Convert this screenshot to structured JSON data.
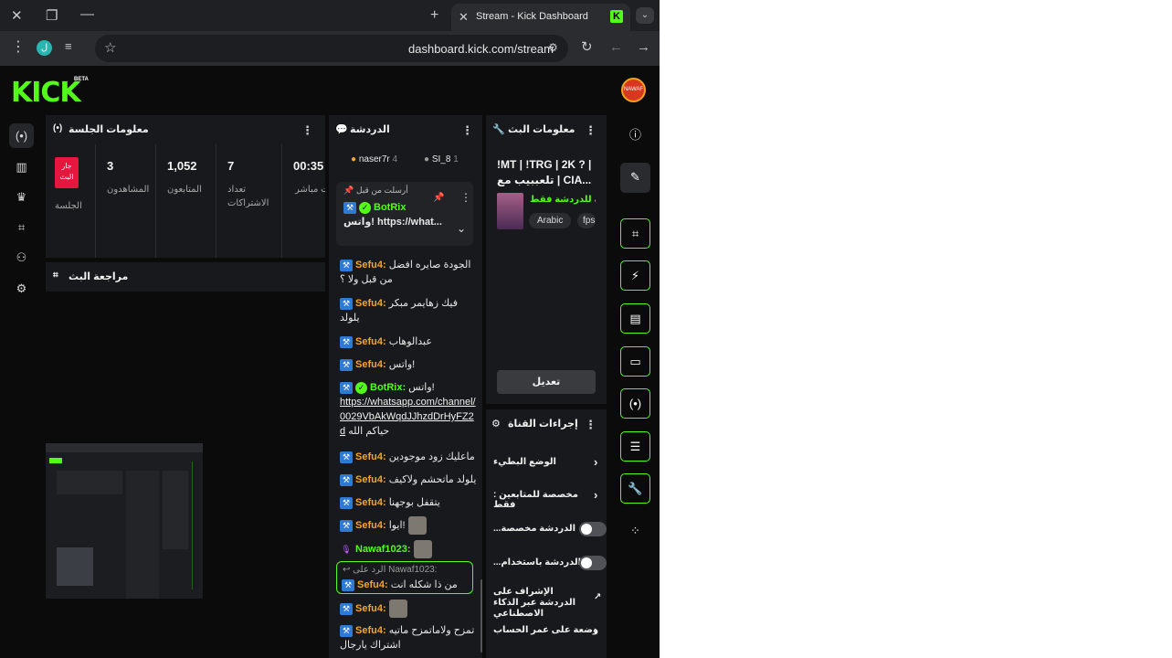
{
  "browser": {
    "tab_title": "Stream - Kick Dashboard",
    "favicon_letter": "K",
    "url": "dashboard.kick.com/stream",
    "profile_letter": "ل"
  },
  "header": {
    "logo": "KICK",
    "beta": "BETA",
    "avatar_text": "NAWAF"
  },
  "session": {
    "title": "معلومات الجلسة",
    "live_badge": "جار البث",
    "live_label": "الجلسة",
    "stats": [
      {
        "value": "3",
        "label": "المشاهدون"
      },
      {
        "value": "1,052",
        "label": "المتابعون"
      },
      {
        "value": "7",
        "label": "تعداد الاشتراكات"
      },
      {
        "value": "00:35",
        "label": "ت مباشر"
      }
    ]
  },
  "review": {
    "title": "مراجعة البث"
  },
  "chat": {
    "title": "الدردشة",
    "top_chatters": [
      {
        "name": "naser7r",
        "count": "4"
      },
      {
        "name": "SI_8",
        "count": "1"
      }
    ],
    "pinned": {
      "sent_by": "أرسلت من قبل",
      "user": "BotRix",
      "text": "واتس! https://what..."
    },
    "messages": [
      {
        "user": "Sefu4:",
        "text": "الجودة صايره افضل من قبل ولا ؟"
      },
      {
        "user": "Sefu4:",
        "text": "فيك زهايمر مبكر يلولد"
      },
      {
        "user": "Sefu4:",
        "text": "عبدالوهاب"
      },
      {
        "user": "Sefu4:",
        "text": "واتس!"
      },
      {
        "user": "BotRix:",
        "text": "واتس!",
        "link": "https://whatsapp.com/channel/0029VbAkWqdJJhzdDrHyFZ2d",
        "after": "حياكم الله"
      },
      {
        "user": "Sefu4:",
        "text": "ماعليك زود موجودين"
      },
      {
        "user": "Sefu4:",
        "text": "يلولد ماتحشم ولاكيف"
      },
      {
        "user": "Sefu4:",
        "text": "يتقفل بوجهنا"
      },
      {
        "user": "Sefu4:",
        "text": "ايوا!"
      },
      {
        "user": "Nawaf1023:",
        "text": ""
      },
      {
        "user": "Sefu4:",
        "text": ""
      },
      {
        "user": "Sefu4:",
        "text": "تمزح ولاماتمزح ماتيه اشتراك يارجال"
      }
    ],
    "reply": {
      "prefix": "الرد على",
      "to_user": "Nawaf1023:",
      "user": "Sefu4:",
      "text": "من ذا شكله انت"
    }
  },
  "stream_info": {
    "title": "معلومات البث",
    "stream_title": "!MT | !TRG | 2K ? | تلعببيب مع | CIA...",
    "category": "مخصصة للدردشة فقط",
    "tags": [
      "Arabic",
      "fps"
    ],
    "edit_label": "تعديل"
  },
  "channel_actions": {
    "title": "إجراءات القناة",
    "rows": [
      {
        "label": "الوضع البطيء",
        "control": "chevron"
      },
      {
        "label": ": مخصصة للمتابعين فقط",
        "control": "chevron"
      },
      {
        "label": "...الدردشة مخصصة",
        "control": "toggle"
      },
      {
        "label": "...الدردشة باستخدام",
        "control": "toggle"
      },
      {
        "label": "الإشراف على الدردشة عبر الذكاء الاصطناعي",
        "control": "external"
      },
      {
        "label": "وضعة على عمر الحساب",
        "control": "chevron"
      }
    ]
  },
  "colors": {
    "brand": "#53fc18",
    "live": "#e6173f",
    "username": "#f5a623",
    "panel": "#18191c"
  },
  "icons": {
    "left_rail": [
      "broadcast-icon",
      "chart-icon",
      "trophy-icon",
      "scan-icon",
      "users-icon",
      "settings-icon"
    ],
    "right_rail": [
      "info-icon",
      "pencil-icon",
      "scan-icon",
      "bolt-icon",
      "notes-icon",
      "chat-icon",
      "broadcast-icon",
      "rows-icon",
      "wrench-icon",
      "bubbles-icon"
    ]
  }
}
